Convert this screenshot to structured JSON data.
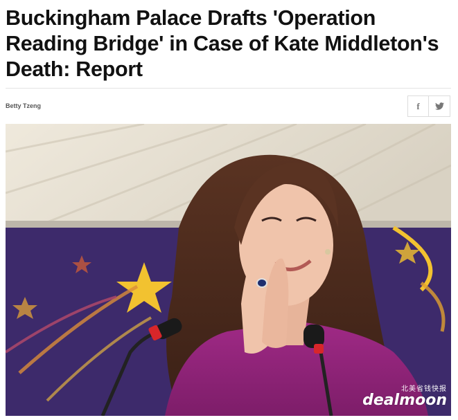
{
  "article": {
    "headline": "Buckingham Palace Drafts 'Operation Reading Bridge' in Case of Kate Middleton's Death: Report",
    "author": "Betty Tzeng"
  },
  "share": {
    "facebook_glyph": "f",
    "twitter_icon": "twitter-icon",
    "facebook_icon": "facebook-icon"
  },
  "watermark": {
    "chinese_text": "北美省钱快报",
    "brand": "dealmoon"
  },
  "colors": {
    "headline": "#111111",
    "author": "#555555",
    "share_icon": "#777777"
  }
}
